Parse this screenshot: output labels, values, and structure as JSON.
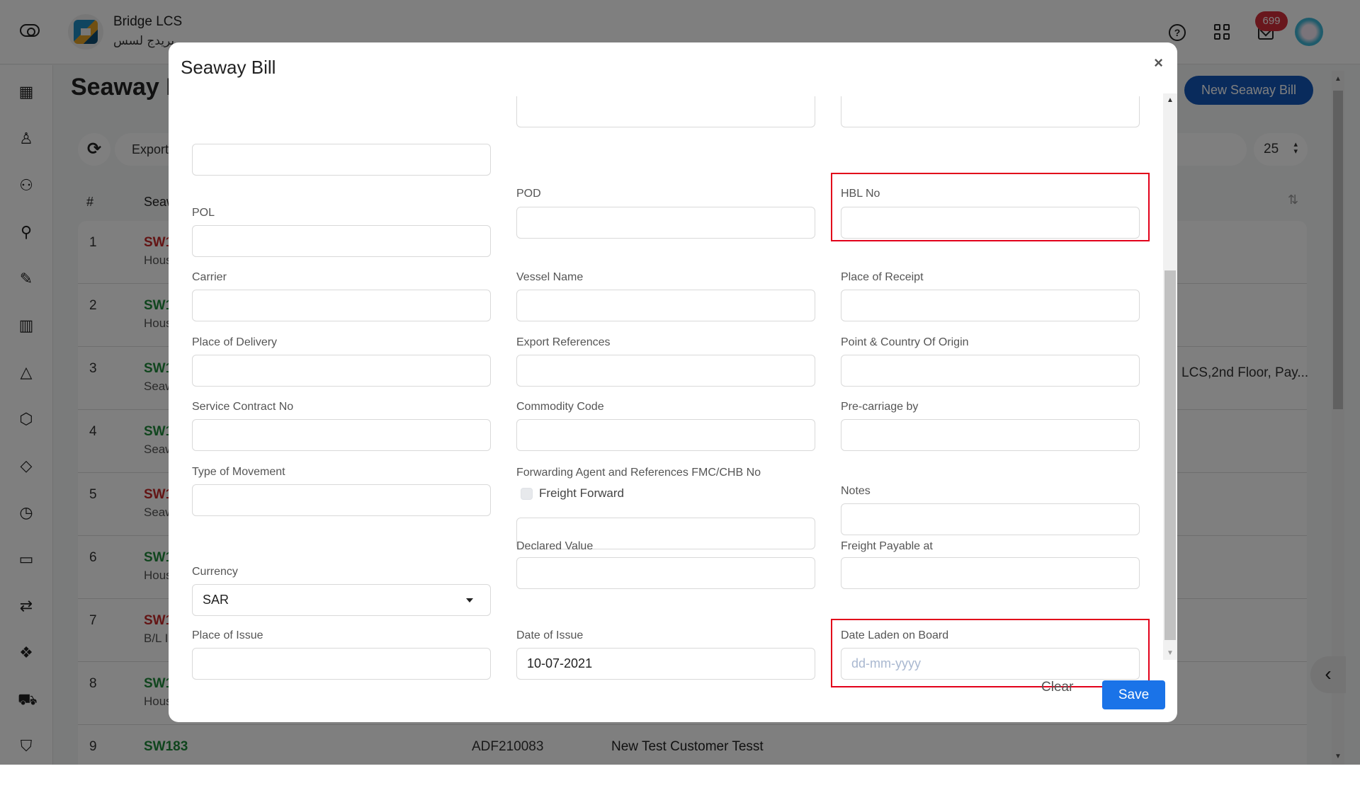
{
  "app": {
    "brand_name": "Bridge LCS",
    "brand_name_ar": "بريدج لسس",
    "notifications_count": "699",
    "colors": {
      "primary": "#1a73e8",
      "header_button": "#1256b8",
      "highlight": "#e2001a",
      "badge": "#d32f3a",
      "status_red": "#c62828",
      "status_green": "#1f8a3a"
    }
  },
  "sidebar": {
    "icons": [
      "dashboard-icon",
      "user-icon",
      "users-icon",
      "user-add-icon",
      "edit-icon",
      "bar-chart-icon",
      "navigation-icon",
      "box-icon",
      "tag-icon",
      "clock-icon",
      "credit-card-icon",
      "repeat-icon",
      "codepen-icon",
      "cart-icon",
      "shield-icon"
    ]
  },
  "page": {
    "title": "Seaway Bill",
    "new_button": "New Seaway Bill",
    "export_label": "Export",
    "page_size": "25",
    "columns": {
      "num": "#",
      "seaway": "Seaway"
    },
    "rows": [
      {
        "num": "1",
        "code": "SW1",
        "status": "red",
        "sub": "Hous"
      },
      {
        "num": "2",
        "code": "SW1",
        "status": "green",
        "sub": "Hous"
      },
      {
        "num": "3",
        "code": "SW1",
        "status": "green",
        "sub": "Seaw",
        "address": "LCS,2nd Floor, Pay..."
      },
      {
        "num": "4",
        "code": "SW1",
        "status": "green",
        "sub": "Seaw"
      },
      {
        "num": "5",
        "code": "SW1",
        "status": "red",
        "sub": "Seaw"
      },
      {
        "num": "6",
        "code": "SW1",
        "status": "green",
        "sub": "Hous"
      },
      {
        "num": "7",
        "code": "SW1",
        "status": "red",
        "sub": "B/L I"
      },
      {
        "num": "8",
        "code": "SW1",
        "status": "green",
        "sub": "Hous"
      },
      {
        "num": "9",
        "code": "SW183",
        "status": "green",
        "sub": "",
        "reference": "ADF210083",
        "customer": "New Test Customer Tesst"
      }
    ]
  },
  "modal": {
    "title": "Seaway Bill",
    "close_label": "×",
    "fields": {
      "pol": {
        "label": "POL",
        "value": ""
      },
      "pod": {
        "label": "POD",
        "value": ""
      },
      "hbl_no": {
        "label": "HBL No",
        "value": ""
      },
      "carrier": {
        "label": "Carrier",
        "value": ""
      },
      "vessel_name": {
        "label": "Vessel Name",
        "value": ""
      },
      "place_of_receipt": {
        "label": "Place of Receipt",
        "value": ""
      },
      "place_of_delivery": {
        "label": "Place of Delivery",
        "value": ""
      },
      "export_references": {
        "label": "Export References",
        "value": ""
      },
      "point_country_origin": {
        "label": "Point & Country Of Origin",
        "value": ""
      },
      "service_contract_no": {
        "label": "Service Contract No",
        "value": ""
      },
      "commodity_code": {
        "label": "Commodity Code",
        "value": ""
      },
      "pre_carriage_by": {
        "label": "Pre-carriage by",
        "value": ""
      },
      "type_of_movement": {
        "label": "Type of Movement",
        "value": ""
      },
      "forwarding_agent": {
        "label": "Forwarding Agent and References FMC/CHB No",
        "value": ""
      },
      "freight_forward": {
        "label": "Freight Forward",
        "checked": false
      },
      "notes": {
        "label": "Notes",
        "value": ""
      },
      "declared_value": {
        "label": "Declared Value",
        "value": ""
      },
      "freight_payable_at": {
        "label": "Freight Payable at",
        "value": ""
      },
      "currency": {
        "label": "Currency",
        "value": "SAR"
      },
      "place_of_issue": {
        "label": "Place of Issue",
        "value": ""
      },
      "date_of_issue": {
        "label": "Date of Issue",
        "value": "10-07-2021"
      },
      "date_laden_on_board": {
        "label": "Date Laden on Board",
        "value": "",
        "placeholder": "dd-mm-yyyy"
      }
    },
    "clear_label": "Clear",
    "save_label": "Save"
  }
}
